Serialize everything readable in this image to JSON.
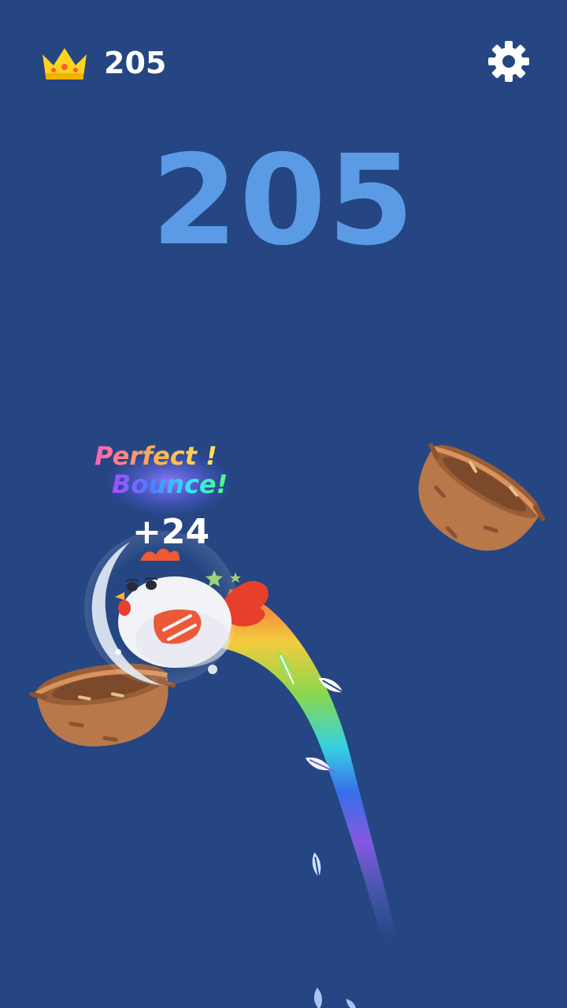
{
  "hud": {
    "best_score": "205",
    "crown_icon": "crown-icon",
    "settings_icon": "gear-icon"
  },
  "game": {
    "score": "205",
    "popup": {
      "line1": "Perfect !",
      "line2": "Bounce!",
      "bonus": "+24"
    },
    "character": "chicken",
    "objects": [
      "nest",
      "nest"
    ],
    "trail": "rainbow"
  },
  "colors": {
    "background": "#254682",
    "score": "#5b9be6",
    "crown": "#ffd21f",
    "nest": "#b9784a"
  }
}
